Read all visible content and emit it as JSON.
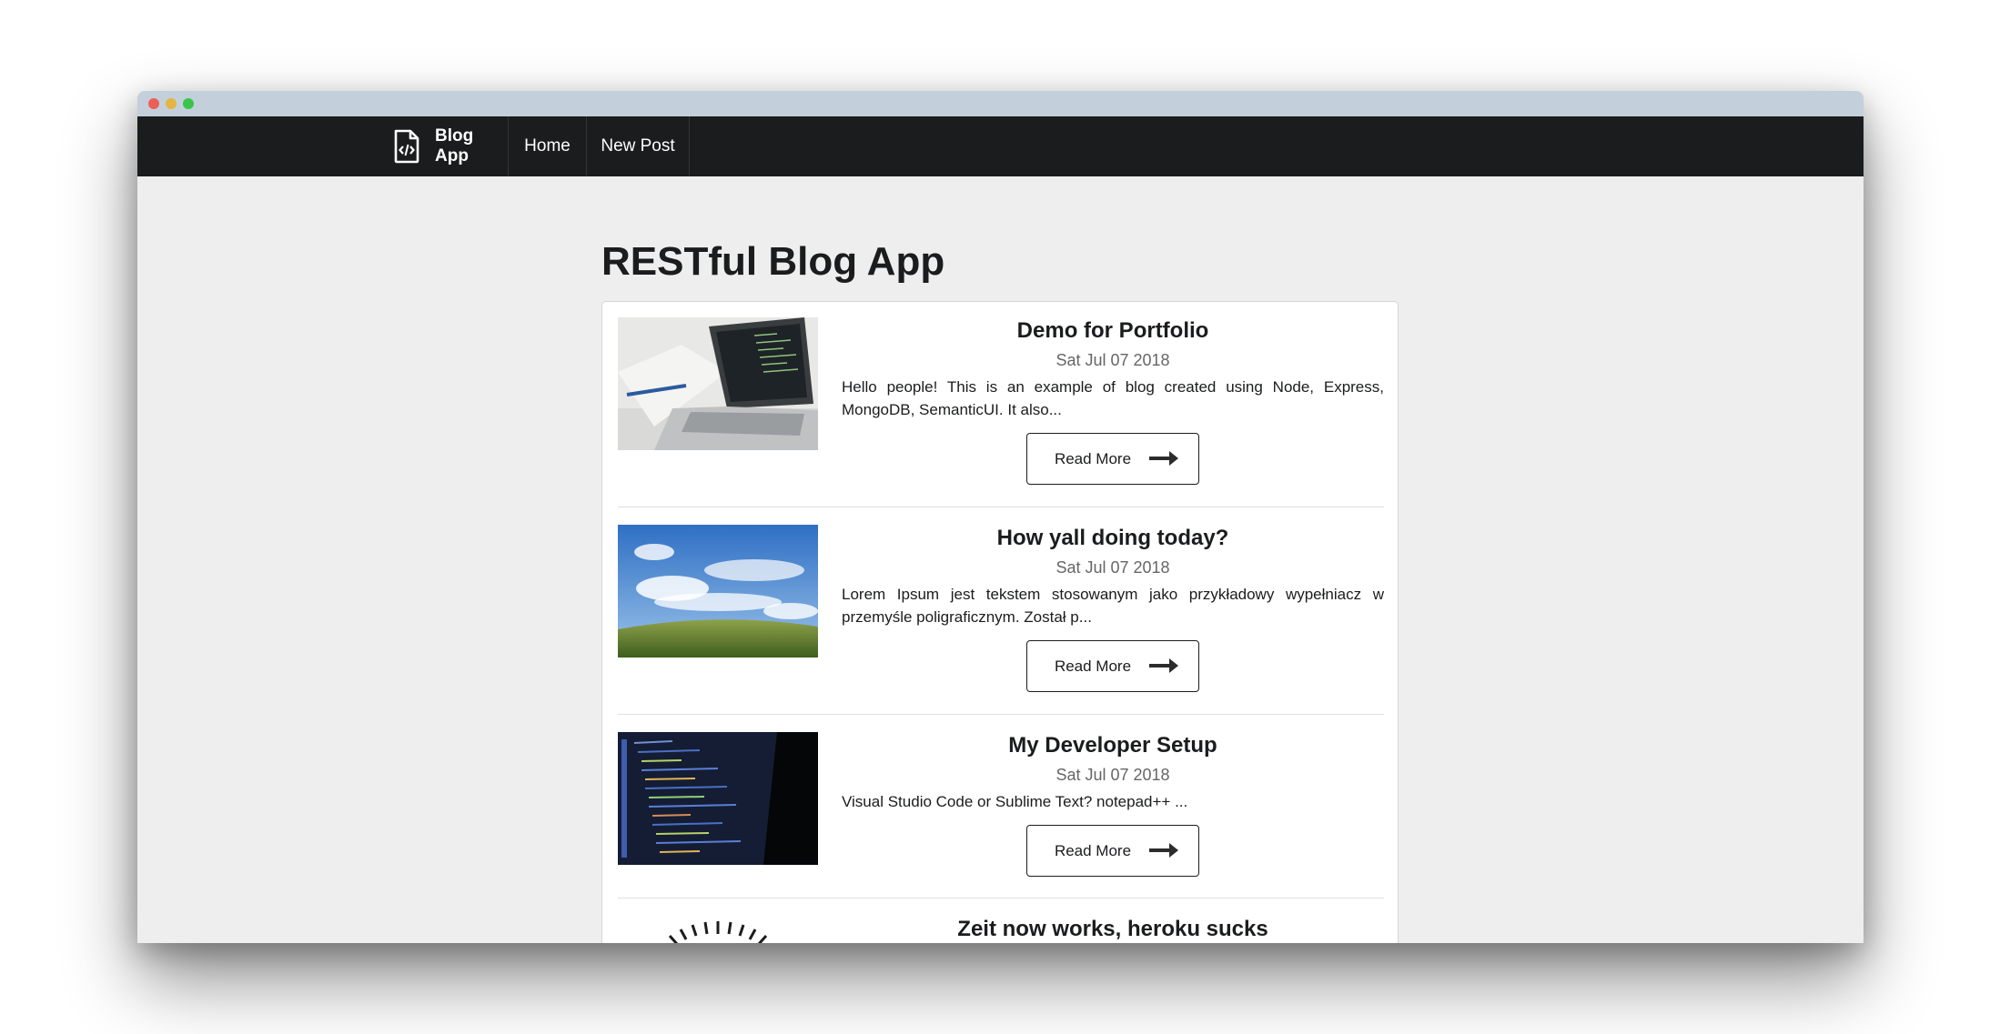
{
  "app": {
    "brand_label": "Blog App"
  },
  "nav": {
    "home_label": "Home",
    "new_post_label": "New Post"
  },
  "page": {
    "title": "RESTful Blog App"
  },
  "posts": [
    {
      "title": "Demo for Portfolio",
      "date": "Sat Jul 07 2018",
      "excerpt": "Hello people! This is an example of blog created using Node, Express, MongoDB, SemanticUI. It also...",
      "button_label": "Read More"
    },
    {
      "title": "How yall doing today?",
      "date": "Sat Jul 07 2018",
      "excerpt": "Lorem Ipsum jest tekstem stosowanym jako przykładowy wypełniacz w przemyśle poligraficznym. Został p...",
      "button_label": "Read More"
    },
    {
      "title": "My Developer Setup",
      "date": "Sat Jul 07 2018",
      "excerpt": "Visual Studio Code or Sublime Text? notepad++ ...",
      "button_label": "Read More"
    },
    {
      "title": "Zeit now works, heroku sucks"
    }
  ],
  "colors": {
    "navbar": "#1b1c1d",
    "page_bg": "#eeeeee",
    "titlebar": "#c3d0db"
  }
}
